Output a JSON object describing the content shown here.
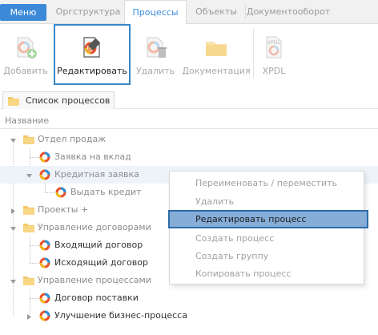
{
  "tabs": {
    "menu": "Меню",
    "items": [
      "Оргструктура",
      "Процессы",
      "Объекты",
      "Документооборот"
    ],
    "active": "Процессы"
  },
  "ribbon": {
    "add": "Добавить",
    "edit": "Редактировать",
    "delete": "Удалить",
    "docs": "Документация",
    "xpdl": "XPDL",
    "xpdl_badge": "XPDL"
  },
  "panel": {
    "tab": "Список процессов",
    "column": "Название"
  },
  "tree": [
    {
      "label": "Отдел продаж",
      "type": "folder",
      "level": 0,
      "expanded": true
    },
    {
      "label": "Заявка на вклад",
      "type": "process",
      "level": 1
    },
    {
      "label": "Кредитная заявка",
      "type": "process",
      "level": 1,
      "expanded": true,
      "highlighted": true
    },
    {
      "label": "Выдать кредит",
      "type": "process",
      "level": 2
    },
    {
      "label": "Проекты +",
      "type": "folder",
      "level": 0,
      "expanded": false
    },
    {
      "label": "Управление договорами",
      "type": "folder",
      "level": 0,
      "expanded": true
    },
    {
      "label": "Входящий договор",
      "type": "process",
      "level": 1
    },
    {
      "label": "Исходящий договор",
      "type": "process",
      "level": 1
    },
    {
      "label": "Управление процессами",
      "type": "folder",
      "level": 0,
      "expanded": true
    },
    {
      "label": "Договор поставки",
      "type": "process",
      "level": 1
    },
    {
      "label": "Улучшение бизнес-процесса",
      "type": "process",
      "level": 1,
      "expanded": false
    }
  ],
  "context_menu": [
    {
      "label": "Переименовать / переместить",
      "active": false
    },
    {
      "label": "Удалить",
      "active": false
    },
    {
      "label": "Редактировать процесс",
      "active": true
    },
    {
      "label": "Создать процесс",
      "active": false
    },
    {
      "label": "Создать группу",
      "active": false
    },
    {
      "label": "Копировать процесс",
      "active": false
    }
  ],
  "colors": {
    "menu_bg": "#3c89d8",
    "active_tab_text": "#3a8de0",
    "selection_border": "#2c6ca8",
    "menu_highlight": "#86acd8",
    "folder": "#f3c96a"
  },
  "icons": {
    "add": "process-add-icon",
    "edit": "process-edit-icon",
    "delete": "process-delete-icon",
    "docs": "folder-icon",
    "xpdl": "xpdl-file-icon",
    "tree_folder": "folder-icon",
    "tree_process": "process-ring-icon"
  }
}
